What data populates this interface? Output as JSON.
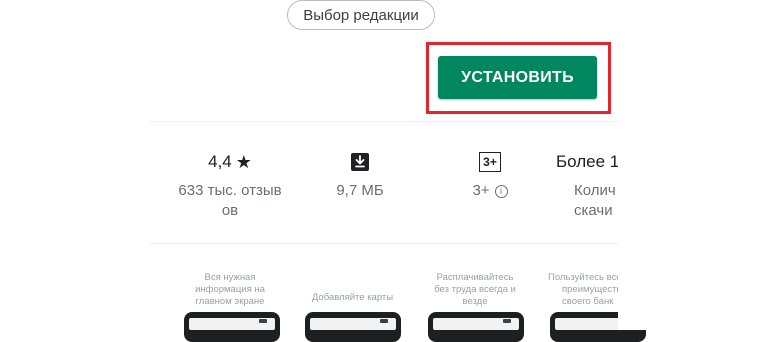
{
  "chip": {
    "label": "Выбор редакции"
  },
  "install": {
    "label": "УСТАНОВИТЬ",
    "highlight_color": "#e0262f",
    "button_color": "#01875f"
  },
  "stats": {
    "rating": {
      "value": "4,4",
      "star": "★",
      "sub_line1": "633 тыс. отзыв",
      "sub_line2": "ов"
    },
    "size": {
      "icon": "download-icon",
      "sub": "9,7 МБ"
    },
    "age": {
      "badge": "3+",
      "sub": "3+",
      "info": "i"
    },
    "installs": {
      "top": "Более 1",
      "sub_line1": "Колич",
      "sub_line2": "скачи"
    }
  },
  "screenshots": [
    {
      "caption_lines": [
        "Вся нужная",
        "информация на",
        "главном экране"
      ]
    },
    {
      "caption_lines": [
        "Добавляйте карты"
      ]
    },
    {
      "caption_lines": [
        "Расплачивайтесь",
        "без труда всегда и",
        "везде"
      ]
    },
    {
      "caption_lines": [
        "Пользуйтесь все",
        "преимуществ",
        "своего банк"
      ]
    }
  ]
}
